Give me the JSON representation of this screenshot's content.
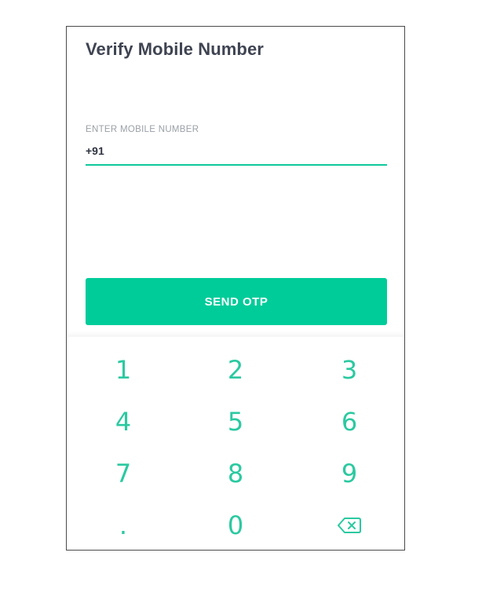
{
  "screen": {
    "title": "Verify Mobile Number"
  },
  "mobile_field": {
    "label": "ENTER MOBILE NUMBER",
    "value": "+91"
  },
  "send_button": {
    "label": "SEND OTP"
  },
  "keypad": {
    "keys": [
      "1",
      "2",
      "3",
      "4",
      "5",
      "6",
      "7",
      "8",
      "9",
      ".",
      "0"
    ],
    "backspace_icon": "backspace-icon"
  },
  "colors": {
    "accent": "#00cc99",
    "title_text": "#3f4452",
    "label_text": "#9aa0a6",
    "key_text": "#2bc9a0"
  }
}
